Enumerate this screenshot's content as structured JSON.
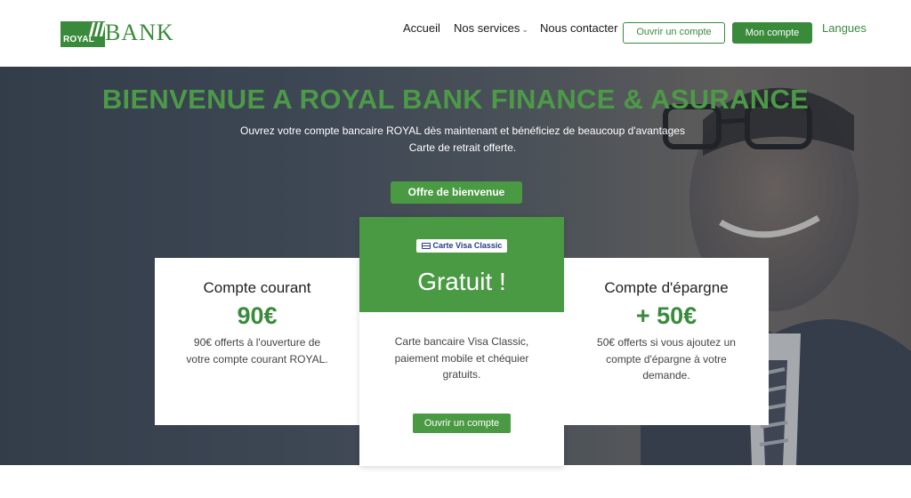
{
  "header": {
    "logo": {
      "badge": "ROYAL",
      "text": "BANK"
    },
    "nav": {
      "home": "Accueil",
      "services": "Nos services",
      "contact": "Nous contacter"
    },
    "open_account_label": "Ouvrir un compte",
    "my_account_label": "Mon compte",
    "languages_label": "Langues"
  },
  "hero": {
    "title": "BIENVENUE A ROYAL BANK FINANCE & ASURANCE",
    "line1": "Ouvrez votre compte bancaire ROYAL dès maintenant et bénéficiez de beaucoup d'avantages",
    "line2": "Carte de retrait offerte.",
    "cta_label": "Offre de bienvenue"
  },
  "cards": {
    "left": {
      "title": "Compte courant",
      "amount": "90€",
      "description": "90€ offerts à l'ouverture de votre compte courant ROYAL."
    },
    "middle": {
      "badge": "Carte Visa Classic",
      "headline": "Gratuit !",
      "description": "Carte bancaire Visa Classic, paiement mobile et chéquier gratuits.",
      "button_label": "Ouvrir un compte"
    },
    "right": {
      "title": "Compte d'épargne",
      "amount": "+ 50€",
      "description": "50€ offerts si vous ajoutez un compte d'épargne à votre demande."
    }
  },
  "colors": {
    "brand_green": "#3a8a3c",
    "accent_green": "#4a9a44"
  }
}
